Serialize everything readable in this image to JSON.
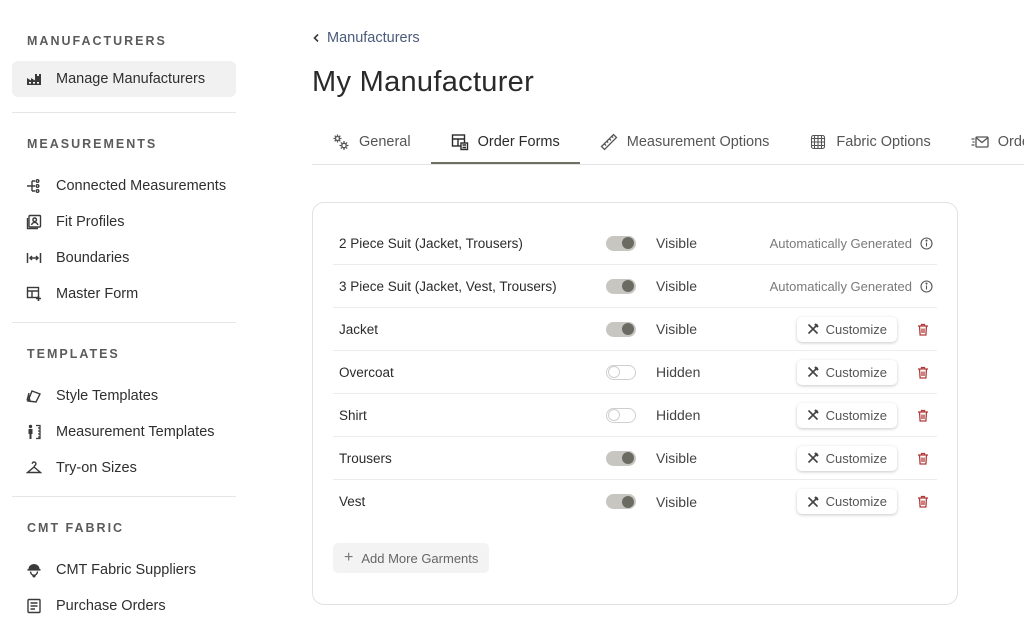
{
  "sidebar": {
    "sections": [
      {
        "title": "MANUFACTURERS",
        "items": [
          {
            "label": "Manage Manufacturers",
            "icon": "factory-icon",
            "active": true
          }
        ]
      },
      {
        "title": "MEASUREMENTS",
        "items": [
          {
            "label": "Connected Measurements",
            "icon": "tree-connect-icon"
          },
          {
            "label": "Fit Profiles",
            "icon": "profile-card-icon"
          },
          {
            "label": "Boundaries",
            "icon": "width-boundary-icon"
          },
          {
            "label": "Master Form",
            "icon": "table-plus-icon"
          }
        ]
      },
      {
        "title": "TEMPLATES",
        "items": [
          {
            "label": "Style Templates",
            "icon": "swatch-fan-icon"
          },
          {
            "label": "Measurement Templates",
            "icon": "person-ruler-icon"
          },
          {
            "label": "Try-on Sizes",
            "icon": "hanger-icon"
          }
        ]
      },
      {
        "title": "CMT FABRIC",
        "items": [
          {
            "label": "CMT Fabric Suppliers",
            "icon": "supplier-icon"
          },
          {
            "label": "Purchase Orders",
            "icon": "document-list-icon"
          }
        ]
      }
    ]
  },
  "breadcrumb": {
    "label": "Manufacturers"
  },
  "page": {
    "title": "My Manufacturer"
  },
  "tabs": [
    {
      "label": "General",
      "icon": "gears-icon",
      "active": false
    },
    {
      "label": "Order Forms",
      "icon": "form-table-icon",
      "active": true
    },
    {
      "label": "Measurement Options",
      "icon": "ruler-icon",
      "active": false
    },
    {
      "label": "Fabric Options",
      "icon": "fabric-grid-icon",
      "active": false
    },
    {
      "label": "Order Se",
      "icon": "mail-list-icon",
      "active": false
    }
  ],
  "garments": [
    {
      "name": "2 Piece Suit (Jacket, Trousers)",
      "enabled": true,
      "status": "Visible",
      "auto": "Automatically Generated"
    },
    {
      "name": "3 Piece Suit (Jacket, Vest, Trousers)",
      "enabled": true,
      "status": "Visible",
      "auto": "Automatically Generated"
    },
    {
      "name": "Jacket",
      "enabled": true,
      "status": "Visible",
      "customize": "Customize"
    },
    {
      "name": "Overcoat",
      "enabled": false,
      "status": "Hidden",
      "customize": "Customize"
    },
    {
      "name": "Shirt",
      "enabled": false,
      "status": "Hidden",
      "customize": "Customize"
    },
    {
      "name": "Trousers",
      "enabled": true,
      "status": "Visible",
      "customize": "Customize"
    },
    {
      "name": "Vest",
      "enabled": true,
      "status": "Visible",
      "customize": "Customize"
    }
  ],
  "add_button": {
    "label": "Add More Garments"
  },
  "colors": {
    "accent": "#6e6e64",
    "danger": "#b23a3a",
    "link": "#4b5b7a"
  }
}
